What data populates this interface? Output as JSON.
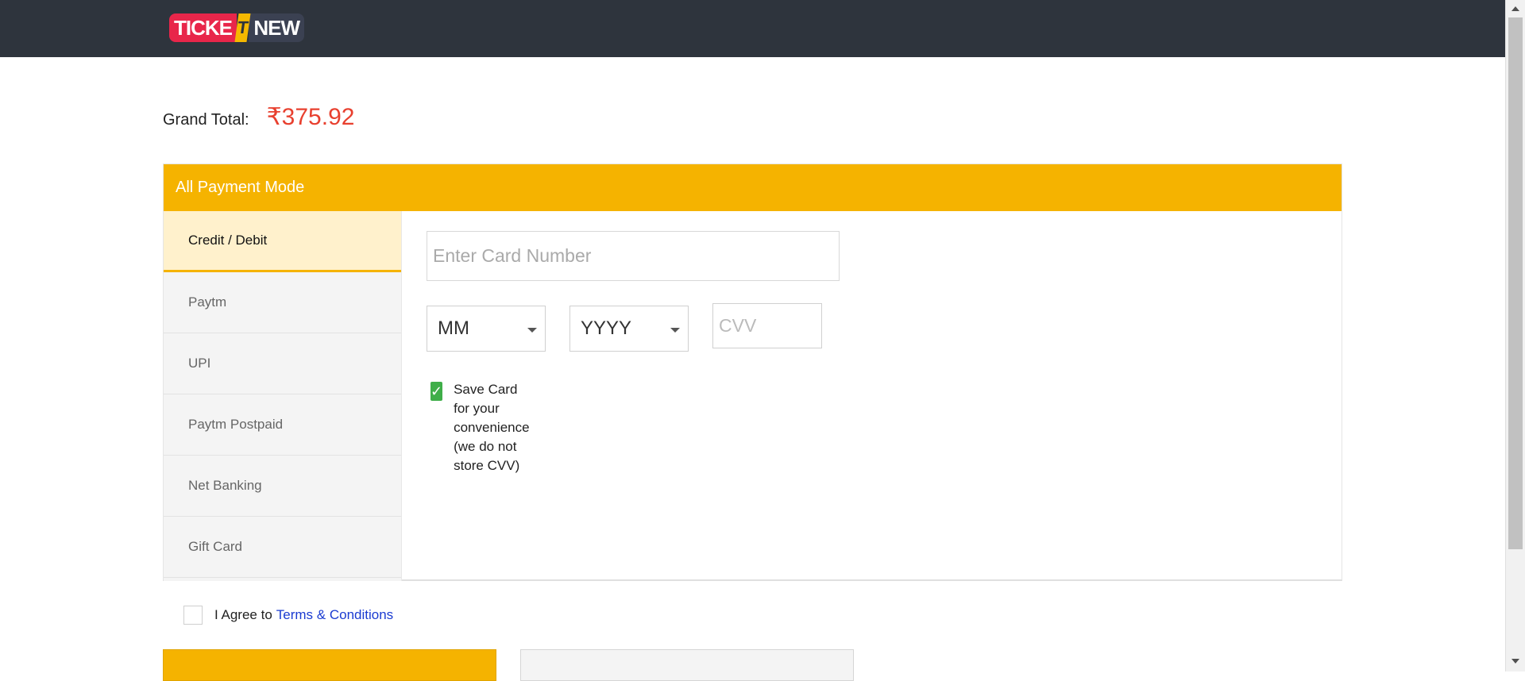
{
  "header": {
    "logo": {
      "left_text": "TICKE",
      "mark": "T",
      "right_text": "NEW"
    }
  },
  "summary": {
    "grand_total_label": "Grand Total:",
    "grand_total_amount": "₹375.92"
  },
  "payment": {
    "header_title": "All Payment Mode",
    "tabs": [
      {
        "label": "Credit / Debit",
        "active": true
      },
      {
        "label": "Paytm",
        "active": false
      },
      {
        "label": "UPI",
        "active": false
      },
      {
        "label": "Paytm Postpaid",
        "active": false
      },
      {
        "label": "Net Banking",
        "active": false
      },
      {
        "label": "Gift Card",
        "active": false
      }
    ],
    "card": {
      "number_placeholder": "Enter Card Number",
      "month_selected": "MM",
      "year_selected": "YYYY",
      "cvv_placeholder": "CVV",
      "save_card_checked": true,
      "save_card_line1": "Save Card for your convenience",
      "save_card_line2": "(we do not store CVV)"
    }
  },
  "agreement": {
    "checked": false,
    "text": "I Agree to",
    "link_text": "Terms & Conditions"
  },
  "colors": {
    "accent": "#f5b300",
    "topbar": "#2e343d",
    "amount": "#e8402f",
    "link": "#1a3bd1",
    "check_green": "#3fae49"
  }
}
